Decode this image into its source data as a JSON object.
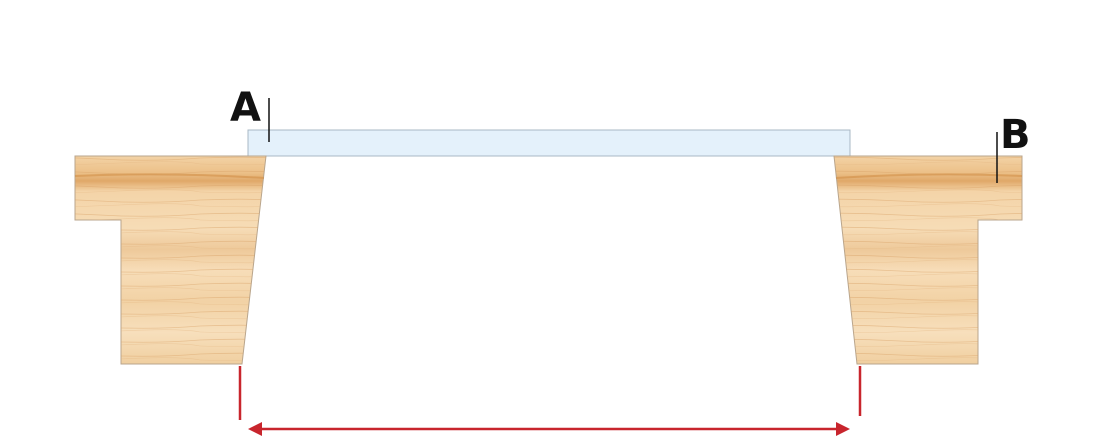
{
  "labels": {
    "a": "A",
    "b": "B"
  },
  "colors": {
    "background": "#ffffff",
    "wood_light": "#f6d9b0",
    "wood_mid": "#efc690",
    "wood_dark": "#d99a52",
    "wood_outline": "#b9a58c",
    "glass_fill": "#e4f1fb",
    "glass_outline": "#a9b8c4",
    "dimension_red": "#c8252d",
    "leader_black": "#111111"
  }
}
